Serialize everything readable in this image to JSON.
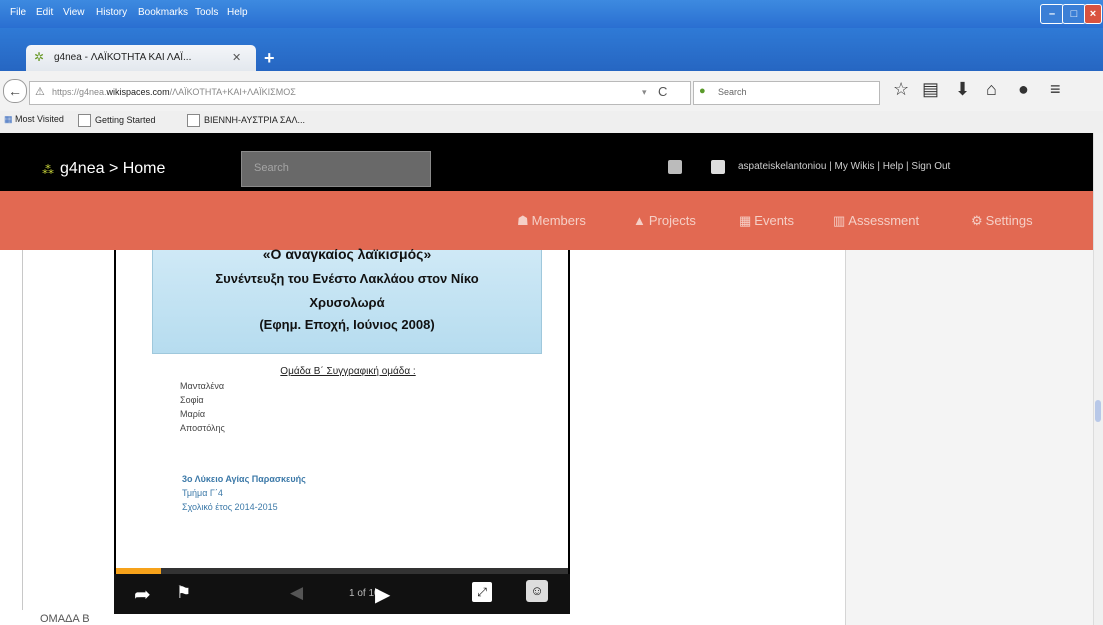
{
  "browser": {
    "menu": [
      "File",
      "Edit",
      "View",
      "History",
      "Bookmarks",
      "Tools",
      "Help"
    ],
    "tab_title": "g4nea - ΛΑΪΚΟΤΗΤΑ ΚΑΙ ΛΑΪ...",
    "url_prefix": "https://g4nea.",
    "url_domain": "wikispaces.com",
    "url_path": "/ΛΑΪΚΟΤΗΤΑ+ΚΑΙ+ΛΑΪΚΙΣΜΟΣ",
    "search_placeholder": "Search",
    "bookmarks": [
      "Most Visited",
      "Getting Started",
      "ΒΙΕΝΝΗ-ΑΥΣΤΡΙΑ ΣΑΛ..."
    ]
  },
  "site": {
    "breadcrumb": "g4nea > Home",
    "search_placeholder": "Search",
    "user_links": "aspateiskelantoniou | My Wikis | Help | Sign Out",
    "nav": [
      {
        "label": "Members",
        "icon": "members-icon"
      },
      {
        "label": "Projects",
        "icon": "projects-icon"
      },
      {
        "label": "Events",
        "icon": "events-icon"
      },
      {
        "label": "Assessment",
        "icon": "assessment-icon"
      },
      {
        "label": "Settings",
        "icon": "settings-icon"
      }
    ]
  },
  "slide": {
    "title_lines": [
      "«Ο αναγκαίος λαϊκισμός»",
      "Συνέντευξη του Ενέστο Λακλάου στον Νίκο",
      "Χρυσολωρά",
      "(Εφημ. Εποχή, Ιούνιος 2008)"
    ],
    "group_title": "Ομάδα Β΄ Συγγραφική ομάδα :",
    "members": [
      "Μανταλένα",
      "Σοφία",
      "Μαρία",
      "Αποστόλης"
    ],
    "school": [
      "3ο Λύκειο Αγίας Παρασκευής",
      "Τμήμα Γ΄4",
      "Σχολικό έτος 2014-2015"
    ]
  },
  "viewer": {
    "page_count": "1 of 10",
    "progress": 0.1
  },
  "footer_label": "ΟΜΑΔΑ Β"
}
